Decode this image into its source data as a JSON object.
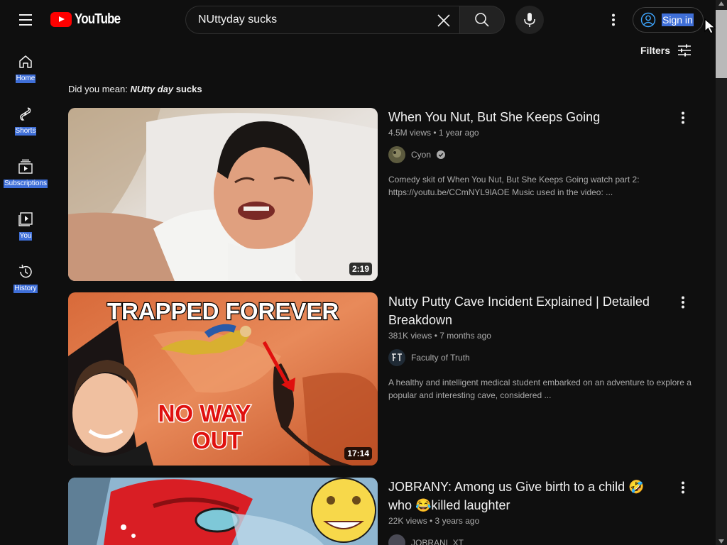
{
  "header": {
    "logo_text": "YouTube",
    "search_value": "NUttyday sucks",
    "signin_label": "Sign in"
  },
  "filters_label": "Filters",
  "sidebar": {
    "items": [
      {
        "label": "Home",
        "icon": "home-icon"
      },
      {
        "label": "Shorts",
        "icon": "shorts-icon"
      },
      {
        "label": "Subscriptions",
        "icon": "subscriptions-icon"
      },
      {
        "label": "You",
        "icon": "you-icon"
      },
      {
        "label": "History",
        "icon": "history-icon"
      }
    ]
  },
  "did_you_mean": {
    "prefix": "Did you mean:",
    "suggestion_a": "NUtty day",
    "suggestion_b": " sucks"
  },
  "results": [
    {
      "title": "When You Nut, But She Keeps Going",
      "meta": "4.5M views • 1 year ago",
      "channel": "Cyon",
      "verified": true,
      "description": "Comedy skit of When You Nut, But She Keeps Going watch part 2: https://youtu.be/CCmNYL9lAOE Music used in the video: ...",
      "duration": "2:19"
    },
    {
      "title": "Nutty Putty Cave Incident Explained | Detailed Breakdown",
      "meta": "381K views • 7 months ago",
      "channel": "Faculty of Truth",
      "verified": false,
      "description": "A healthy and intelligent medical student embarked on an adventure to explore a popular and interesting cave, considered ...",
      "duration": "17:14",
      "thumb_text_top": "TRAPPED FOREVER",
      "thumb_text_bottom_1": "NO WAY",
      "thumb_text_bottom_2": "OUT"
    },
    {
      "title": "JOBRANY: Among us Give birth to a child 🤣who 😂killed laughter",
      "meta": "22K views • 3 years ago",
      "channel": "JOBRANI_XT",
      "verified": false,
      "description": "",
      "duration": ""
    }
  ]
}
